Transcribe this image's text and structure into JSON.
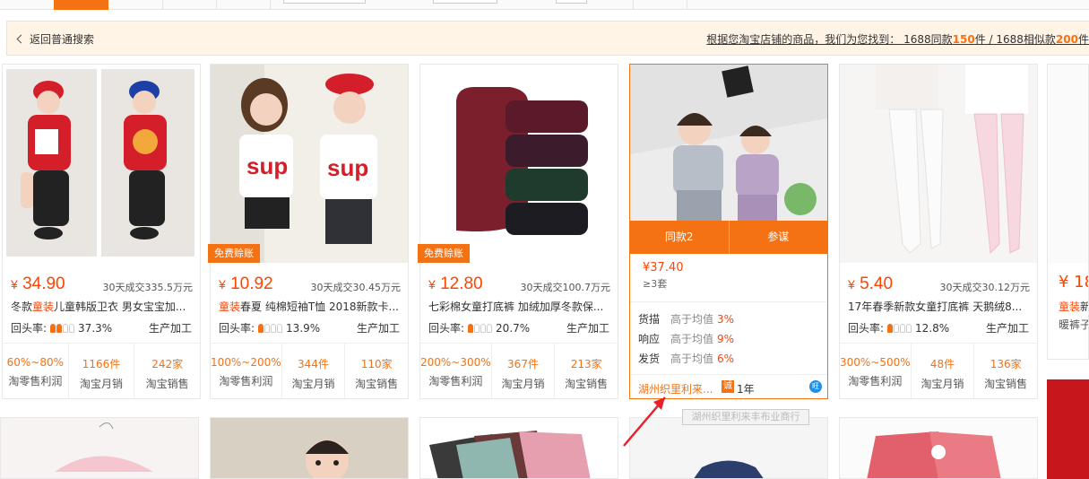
{
  "banner": {
    "back_label": "返回普通搜索",
    "found_prefix": "根据您淘宝店铺的商品，我们为您找到：  1688同款",
    "same_count": "150",
    "found_mid": "件 / 1688相似款",
    "similar_count": "200",
    "found_suffix": "件"
  },
  "products": [
    {
      "price": "34.90",
      "sold": "30天成交335.5万元",
      "title_pre": "冬款",
      "title_hot": "童装",
      "title_post": "儿童韩版卫衣 男女宝宝加...",
      "repeat": "37.3%",
      "factory": "生产加工",
      "profit": "60%~80%",
      "monthly": "1166件",
      "sellers": "242家",
      "tag": ""
    },
    {
      "price": "10.92",
      "sold": "30天成交30.45万元",
      "title_pre": "",
      "title_hot": "童装",
      "title_post": "春夏 纯棉短袖T恤 2018新款卡...",
      "repeat": "13.9%",
      "factory": "生产加工",
      "profit": "100%~200%",
      "monthly": "344件",
      "sellers": "110家",
      "tag": "免费赊账"
    },
    {
      "price": "12.80",
      "sold": "30天成交100.7万元",
      "title_pre": "七彩棉女童打底裤 加绒加厚冬款保...",
      "title_hot": "",
      "title_post": "",
      "repeat": "20.7%",
      "factory": "生产加工",
      "profit": "200%~300%",
      "monthly": "367件",
      "sellers": "213家",
      "tag": "免费赊账"
    },
    {
      "price": "5.40",
      "sold": "30天成交30.12万元",
      "title_pre": "17年春季新款女童打底裤 天鹅绒8...",
      "title_hot": "",
      "title_post": "",
      "repeat": "12.8%",
      "factory": "生产加工",
      "profit": "300%~500%",
      "monthly": "48件",
      "sellers": "136家",
      "tag": ""
    }
  ],
  "stat_labels": {
    "profit": "淘零售利润",
    "monthly": "淘宝月销",
    "sellers": "淘宝销售"
  },
  "repeat_label": "回头率:",
  "currency": "¥",
  "hover": {
    "same_btn": "同款2",
    "ref_btn": "参谋",
    "price": "¥37.40",
    "qty": "≥3套",
    "rows": [
      {
        "k": "货描",
        "g": "高于均值",
        "r": "3%"
      },
      {
        "k": "响应",
        "g": "高于均值",
        "r": "9%"
      },
      {
        "k": "发货",
        "g": "高于均值",
        "r": "6%"
      }
    ],
    "shop": "湖州织里利来...",
    "cheng": "诚",
    "years": "1年",
    "wang": "旺",
    "tooltip": "湖州织里利来丰布业商行"
  },
  "side": {
    "price": "¥ 18",
    "title_hot": "童装",
    "title_post": "新",
    "sub": "暖裤子"
  },
  "colors": {
    "accent": "#f57214",
    "price": "#ff4400"
  }
}
